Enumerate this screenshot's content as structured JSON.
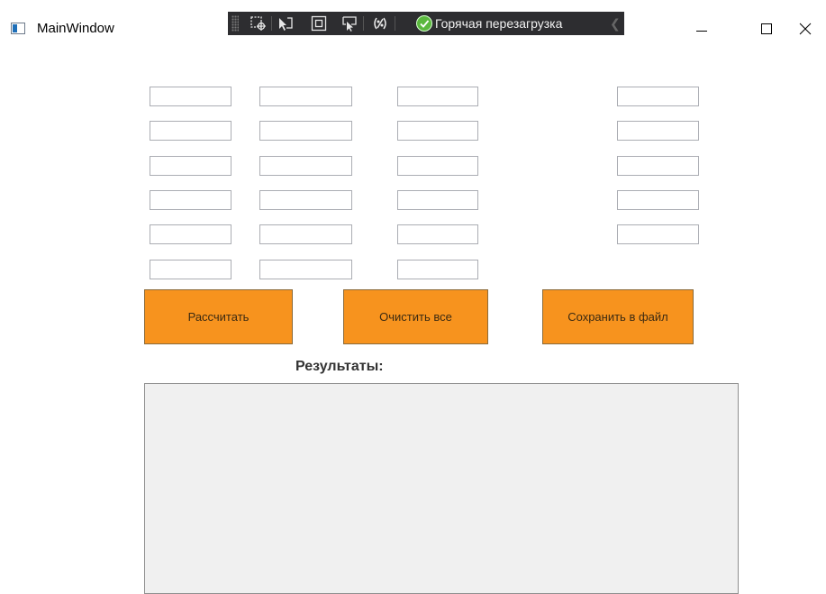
{
  "window": {
    "title": "MainWindow",
    "icon": "wpf-window-icon"
  },
  "debug_toolbar": {
    "hot_reload_label": "Горячая перезагрузка",
    "icons": [
      "select-element-icon",
      "select-pointer-icon",
      "layout-adorner-icon",
      "track-focus-icon",
      "binding-failures-icon",
      "hot-reload-check-icon",
      "chevron-left-icon"
    ]
  },
  "caption_buttons": {
    "minimize": "minimize-icon",
    "maximize": "maximize-icon",
    "close": "close-icon"
  },
  "inputs": {
    "col1": [
      "",
      "",
      "",
      "",
      "",
      ""
    ],
    "col2": [
      "",
      "",
      "",
      "",
      "",
      ""
    ],
    "col3": [
      "",
      "",
      "",
      "",
      "",
      ""
    ],
    "col4": [
      "",
      "",
      "",
      "",
      ""
    ]
  },
  "buttons": {
    "calculate": "Рассчитать",
    "clear_all": "Очистить все",
    "save_file": "Сохранить в файл"
  },
  "results": {
    "label": "Результаты:",
    "text": ""
  },
  "colors": {
    "button_bg": "#f7931e",
    "results_bg": "#f0f0f0",
    "toolbar_bg": "#2d2d30"
  }
}
